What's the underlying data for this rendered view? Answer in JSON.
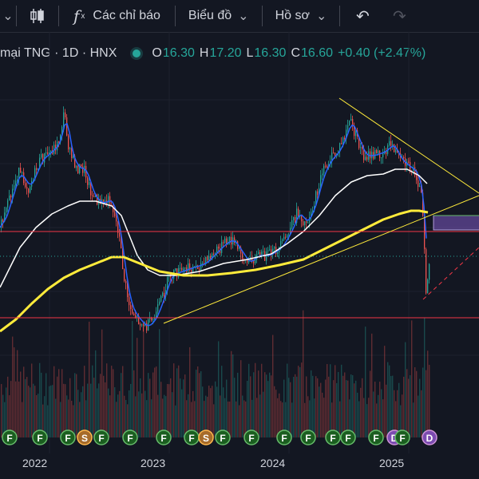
{
  "toolbar": {
    "indicators_label": "Các chỉ báo",
    "layout_label": "Biểu đồ",
    "profile_label": "Hồ sơ",
    "chevron_glyph": "⌄",
    "undo_glyph": "↶",
    "redo_glyph": "↷"
  },
  "legend": {
    "symbol": "mại TNG · 1D · HNX",
    "open_label": "O",
    "open": "16.30",
    "high_label": "H",
    "high": "17.20",
    "low_label": "L",
    "low": "16.30",
    "close_label": "C",
    "close": "16.60",
    "change": "+0.40 (+2.47%)",
    "up_color": "#26a69a",
    "down_color": "#ef5350"
  },
  "events": [
    "F",
    "F",
    "F",
    "S",
    "F",
    "F",
    "F",
    "F",
    "S",
    "F",
    "F",
    "F",
    "F",
    "F",
    "F",
    "F",
    "D",
    "F",
    "D",
    "F",
    "F"
  ],
  "x_axis": {
    "labels": [
      "2022",
      "2023",
      "2024",
      "2025"
    ]
  },
  "chart_data": {
    "type": "candlestick",
    "series": [
      {
        "name": "Price",
        "color": "#26a69a"
      },
      {
        "name": "MA fast",
        "color": "#2962ff"
      },
      {
        "name": "MA mid",
        "color": "#ffffff"
      },
      {
        "name": "MA slow",
        "color": "#ffeb3b"
      }
    ],
    "last_close": 16.6
  }
}
